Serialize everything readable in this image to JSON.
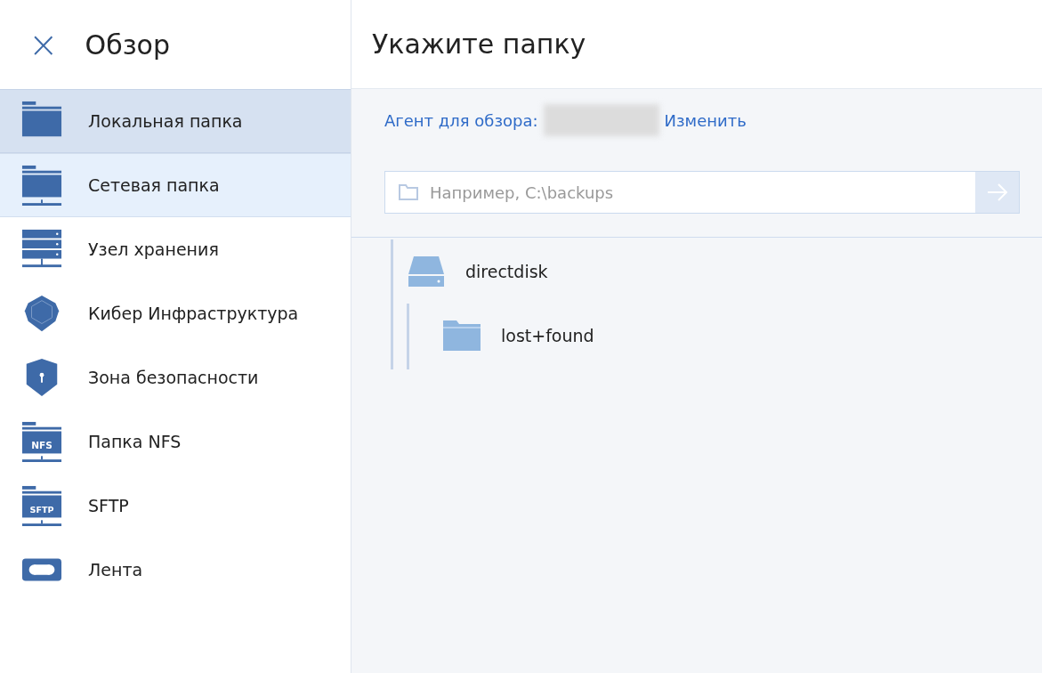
{
  "sidebar": {
    "close": "×",
    "title": "Обзор",
    "items": [
      {
        "label": "Локальная папка",
        "kind": "folder",
        "selected": true,
        "hovered": false
      },
      {
        "label": "Сетевая папка",
        "kind": "network-folder",
        "selected": false,
        "hovered": true
      },
      {
        "label": "Узел хранения",
        "kind": "server",
        "selected": false,
        "hovered": false
      },
      {
        "label": "Кибер Инфраструктура",
        "kind": "hexagon",
        "selected": false,
        "hovered": false
      },
      {
        "label": "Зона безопасности",
        "kind": "shield",
        "selected": false,
        "hovered": false
      },
      {
        "label": "Папка NFS",
        "kind": "labeled-folder",
        "badge": "NFS",
        "selected": false,
        "hovered": false
      },
      {
        "label": "SFTP",
        "kind": "labeled-folder",
        "badge": "SFTP",
        "selected": false,
        "hovered": false
      },
      {
        "label": "Лента",
        "kind": "tape",
        "selected": false,
        "hovered": false
      }
    ]
  },
  "main": {
    "title": "Укажите папку",
    "agent_label": "Агент для обзора:",
    "change_link": "Изменить",
    "path_field": {
      "placeholder": "Например, C:\\backups"
    },
    "tree": [
      {
        "label": "directdisk",
        "kind": "disk",
        "children": [
          {
            "label": "lost+found",
            "kind": "folder"
          }
        ]
      }
    ]
  }
}
